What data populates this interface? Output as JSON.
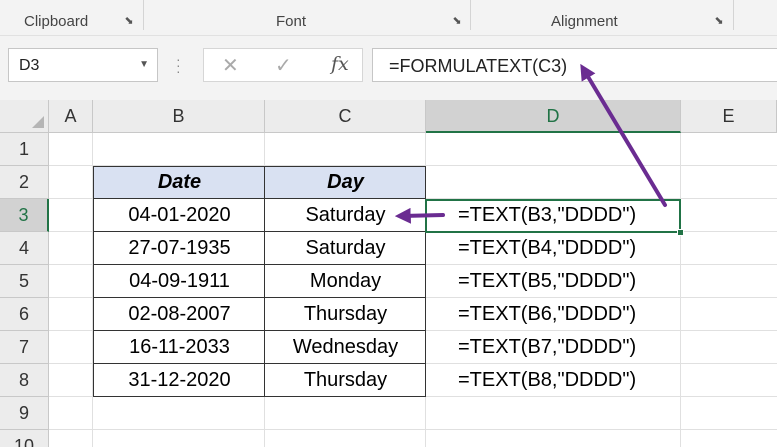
{
  "ribbon": {
    "groups": [
      {
        "label": "Clipboard"
      },
      {
        "label": "Font"
      },
      {
        "label": "Alignment"
      }
    ]
  },
  "formula_bar": {
    "name_box": "D3",
    "fx_label": "fx",
    "formula": "=FORMULATEXT(C3)"
  },
  "columns": [
    "A",
    "B",
    "C",
    "D",
    "E"
  ],
  "rows": [
    "1",
    "2",
    "3",
    "4",
    "5",
    "6",
    "7",
    "8",
    "9",
    "10"
  ],
  "active_cell": {
    "column": "D",
    "row": "3"
  },
  "table": {
    "headers": [
      "Date",
      "Day"
    ],
    "rows": [
      {
        "date": "04-01-2020",
        "day": "Saturday",
        "formula": "=TEXT(B3,\"DDDD\")"
      },
      {
        "date": "27-07-1935",
        "day": "Saturday",
        "formula": "=TEXT(B4,\"DDDD\")"
      },
      {
        "date": "04-09-1911",
        "day": "Monday",
        "formula": "=TEXT(B5,\"DDDD\")"
      },
      {
        "date": "02-08-2007",
        "day": "Thursday",
        "formula": "=TEXT(B6,\"DDDD\")"
      },
      {
        "date": "16-11-2033",
        "day": "Wednesday",
        "formula": "=TEXT(B7,\"DDDD\")"
      },
      {
        "date": "31-12-2020",
        "day": "Thursday",
        "formula": "=TEXT(B8,\"DDDD\")"
      }
    ]
  },
  "colors": {
    "accent": "#217346",
    "header_fill": "#d9e1f2",
    "arrow": "#6a2c91"
  }
}
